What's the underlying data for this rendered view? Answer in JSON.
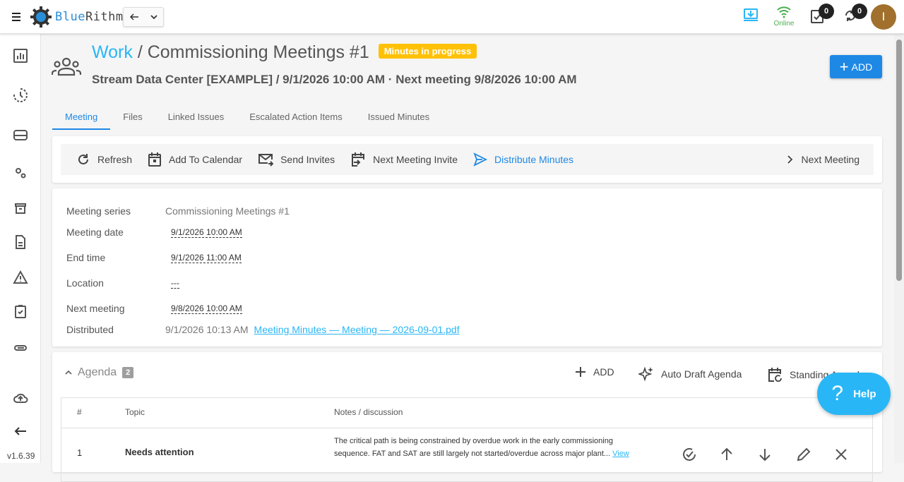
{
  "app": {
    "brand_prefix": "Blue",
    "brand_suffix": "Rithm",
    "version": "v1.6.39",
    "online_label": "Online",
    "tasks_count": "0",
    "sync_count": "0",
    "avatar_initial": "I",
    "help_label": "Help"
  },
  "header": {
    "breadcrumb": "Work",
    "separator": " / ",
    "title": "Commissioning Meetings #1",
    "status": "Minutes in progress",
    "subtitle": "Stream Data Center [EXAMPLE] / 9/1/2026 10:00 AM · Next meeting 9/8/2026 10:00 AM",
    "add_label": "ADD"
  },
  "tabs": [
    "Meeting",
    "Files",
    "Linked Issues",
    "Escalated Action Items",
    "Issued Minutes"
  ],
  "toolbar": {
    "refresh": "Refresh",
    "calendar": "Add To Calendar",
    "invites": "Send Invites",
    "next_invite": "Next Meeting Invite",
    "distribute": "Distribute Minutes",
    "next_meeting": "Next Meeting"
  },
  "details": {
    "series_label": "Meeting series",
    "series_value": "Commissioning Meetings #1",
    "date_label": "Meeting date",
    "date_value": "9/1/2026 10:00 AM",
    "end_label": "End time",
    "end_value": "9/1/2026 11:00 AM",
    "location_label": "Location",
    "location_value": "---",
    "next_label": "Next meeting",
    "next_value": "9/8/2026 10:00 AM",
    "distributed_label": "Distributed",
    "distributed_value": "9/1/2026 10:13 AM",
    "distributed_link": "Meeting Minutes — Meeting — 2026-09-01.pdf"
  },
  "agenda": {
    "title": "Agenda",
    "count": "2",
    "add_label": "ADD",
    "auto_draft": "Auto Draft Agenda",
    "standing": "Standing Agenda",
    "columns": [
      "#",
      "Topic",
      "Notes / discussion"
    ],
    "rows": [
      {
        "num": "1",
        "topic": "Needs attention",
        "notes": "The critical path is being constrained by overdue work in the early commissioning sequence. FAT and SAT are still largely not started/overdue across major plant...",
        "view": "View"
      }
    ]
  },
  "colors": {
    "accent": "#1e88e5",
    "link": "#29b6f6",
    "status_chip": "#ffc107",
    "online": "#4caf50"
  }
}
